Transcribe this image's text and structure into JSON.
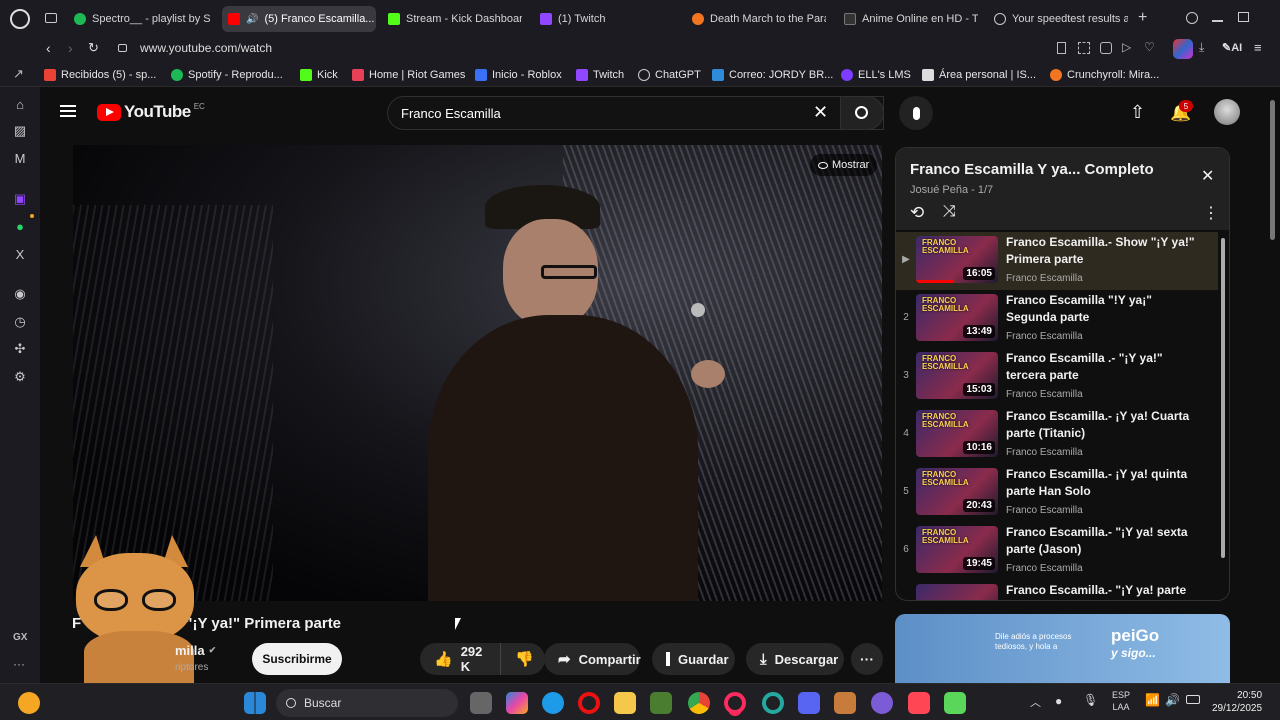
{
  "tabs": [
    {
      "title": "Spectro__ - playlist by Sp",
      "color": "#1db954"
    },
    {
      "title": "(5) Franco Escamilla...",
      "color": "#ff0000"
    },
    {
      "title": "Stream - Kick Dashboard",
      "color": "#53fc18"
    },
    {
      "title": "(1) Twitch",
      "color": "#9146ff"
    },
    {
      "title": "Death March to the Para",
      "color": "#f47521"
    },
    {
      "title": "Anime Online en HD - T",
      "color": "#333333"
    },
    {
      "title": "Your speedtest results a",
      "color": "#cccccc"
    }
  ],
  "address": {
    "url": "www.youtube.com/watch",
    "ai_label": "AI"
  },
  "bookmarks": [
    {
      "label": "Recibidos (5) - sp...",
      "color": "#ea4335"
    },
    {
      "label": "Spotify - Reprodu...",
      "color": "#1db954"
    },
    {
      "label": "Kick",
      "color": "#53fc18"
    },
    {
      "label": "Home | Riot Games",
      "color": "#e84057"
    },
    {
      "label": "Inicio - Roblox",
      "color": "#3a6ff7"
    },
    {
      "label": "Twitch",
      "color": "#9146ff"
    },
    {
      "label": "ChatGPT",
      "color": "#cccccc"
    },
    {
      "label": "Correo: JORDY BR...",
      "color": "#2f8bd8"
    },
    {
      "label": "ELL's LMS",
      "color": "#7d3cff"
    },
    {
      "label": "Área personal | IS...",
      "color": "#dddddd"
    },
    {
      "label": "Crunchyroll: Mira...",
      "color": "#f47521"
    }
  ],
  "youtube": {
    "logo_text": "YouTube",
    "country": "EC",
    "search_value": "Franco Escamilla",
    "notifications": "5",
    "show_button": "Mostrar",
    "video_title": "F   milla.- Show \"¡Y ya!\" Primera parte",
    "channel": "milla",
    "subs": "riptores",
    "subscribe": "Suscribirme",
    "likes": "292 K",
    "share": "Compartir",
    "save": "Guardar",
    "download": "Descargar"
  },
  "playlist": {
    "title": "Franco Escamilla Y ya... Completo",
    "owner": "Josué Peña - 1/7",
    "thumb_label": "FRANCO ESCAMILLA",
    "items": [
      {
        "index": "▶",
        "title": "Franco Escamilla.- Show \"¡Y ya!\" Primera parte",
        "channel": "Franco Escamilla",
        "duration": "16:05"
      },
      {
        "index": "2",
        "title": "Franco Escamilla \"!Y ya¡\" Segunda parte",
        "channel": "Franco Escamilla",
        "duration": "13:49"
      },
      {
        "index": "3",
        "title": "Franco Escamilla .- \"¡Y ya!\" tercera parte",
        "channel": "Franco Escamilla",
        "duration": "15:03"
      },
      {
        "index": "4",
        "title": "Franco Escamilla.- ¡Y ya! Cuarta parte (Titanic)",
        "channel": "Franco Escamilla",
        "duration": "10:16"
      },
      {
        "index": "5",
        "title": "Franco Escamilla.- ¡Y ya! quinta parte Han Solo",
        "channel": "Franco Escamilla",
        "duration": "20:43"
      },
      {
        "index": "6",
        "title": "Franco Escamilla.- \"¡Y ya! sexta parte (Jason)",
        "channel": "Franco Escamilla",
        "duration": "19:45"
      },
      {
        "index": "",
        "title": "Franco Escamilla.- \"¡Y ya! parte",
        "channel": "",
        "duration": ""
      }
    ]
  },
  "ad": {
    "text1": "Dile adiós a procesos tediosos, y hola a",
    "brand": "peiGo",
    "tagline": "y sigo..."
  },
  "taskbar": {
    "search": "Buscar",
    "lang1": "ESP",
    "lang2": "LAA",
    "time": "20:50",
    "date": "29/12/2025"
  },
  "sidebar_gx": "GX"
}
